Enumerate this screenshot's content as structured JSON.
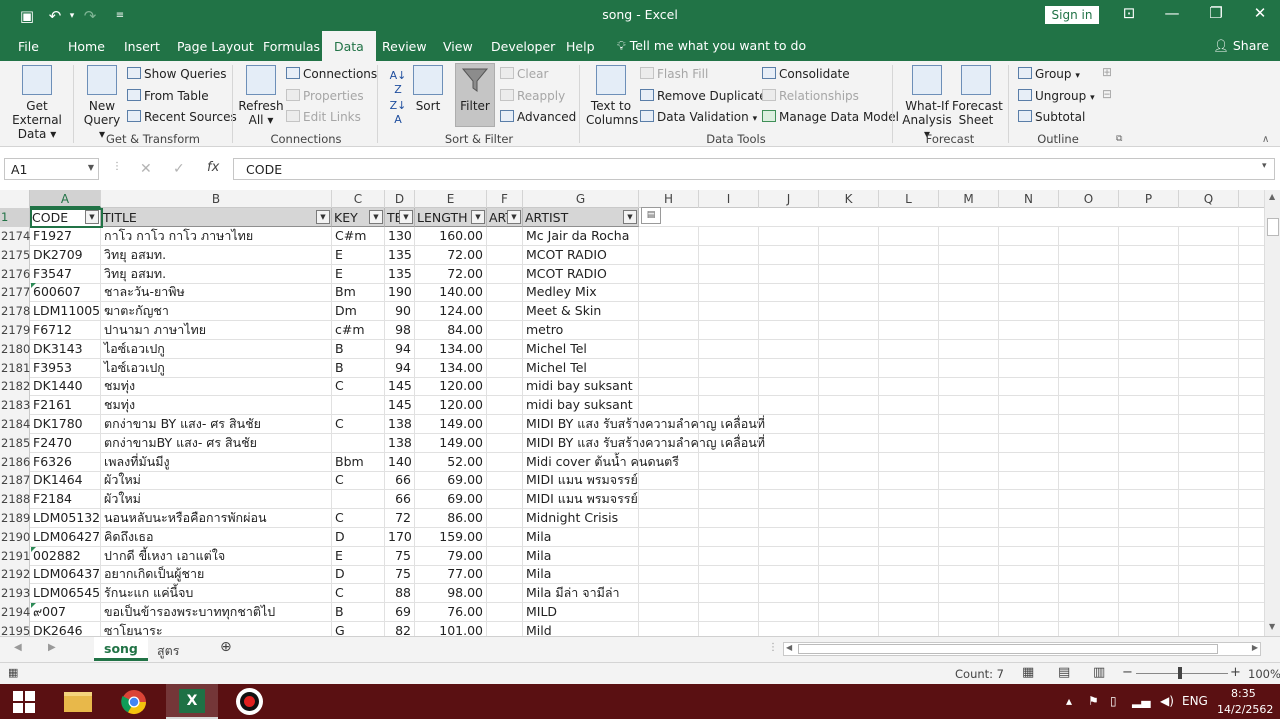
{
  "window": {
    "title": "song  -  Excel",
    "sign_in": "Sign in"
  },
  "tabs": {
    "file": "File",
    "home": "Home",
    "insert": "Insert",
    "page_layout": "Page Layout",
    "formulas": "Formulas",
    "data": "Data",
    "review": "Review",
    "view": "View",
    "developer": "Developer",
    "help": "Help",
    "tell_me": "Tell me what you want to do",
    "share": "Share"
  },
  "ribbon": {
    "get_external_data": [
      "Get External",
      "Data ▾"
    ],
    "new_query": [
      "New",
      "Query ▾"
    ],
    "show_queries": "Show Queries",
    "from_table": "From Table",
    "recent_sources": "Recent Sources",
    "get_transform_label": "Get & Transform",
    "refresh_all": [
      "Refresh",
      "All ▾"
    ],
    "connections": "Connections",
    "properties": "Properties",
    "edit_links": "Edit Links",
    "connections_label": "Connections",
    "sort": "Sort",
    "filter": "Filter",
    "clear": "Clear",
    "reapply": "Reapply",
    "advanced": "Advanced",
    "sort_filter_label": "Sort & Filter",
    "text_to_columns": [
      "Text to",
      "Columns"
    ],
    "flash_fill": "Flash Fill",
    "remove_duplicates": "Remove Duplicates",
    "data_validation": "Data Validation",
    "consolidate": "Consolidate",
    "relationships": "Relationships",
    "manage_data_model": "Manage Data Model",
    "data_tools_label": "Data Tools",
    "what_if": [
      "What-If",
      "Analysis ▾"
    ],
    "forecast_sheet": [
      "Forecast",
      "Sheet"
    ],
    "forecast_label": "Forecast",
    "group": "Group",
    "ungroup": "Ungroup",
    "subtotal": "Subtotal",
    "outline_label": "Outline"
  },
  "formula_bar": {
    "name_box": "A1",
    "cancel": "✕",
    "enter": "✓",
    "fx": "fx",
    "value": "CODE"
  },
  "columns": [
    "A",
    "B",
    "C",
    "D",
    "E",
    "F",
    "G",
    "H",
    "I",
    "J",
    "K",
    "L",
    "M",
    "N",
    "O",
    "P",
    "Q"
  ],
  "header_row": {
    "row_number": "1",
    "cells": [
      "CODE",
      "TITLE",
      "KEY",
      "TE",
      "LENGTH",
      "ART",
      "ARTIST"
    ]
  },
  "rows": [
    {
      "n": "2174",
      "code": "F1927",
      "title": "กาโว กาโว กาโว ภาษาไทย",
      "key": "C#m",
      "tempo": "130",
      "length": "160.00",
      "artist": "Mc Jair da Rocha",
      "tri": false
    },
    {
      "n": "2175",
      "code": "DK2709",
      "title": "วิทยุ อสมท.",
      "key": "E",
      "tempo": "135",
      "length": "72.00",
      "artist": "MCOT RADIO",
      "tri": false
    },
    {
      "n": "2176",
      "code": "F3547",
      "title": "วิทยุ อสมท.",
      "key": "E",
      "tempo": "135",
      "length": "72.00",
      "artist": "MCOT RADIO",
      "tri": false
    },
    {
      "n": "2177",
      "code": "600607",
      "title": "ชาละวัน-ยาพิษ",
      "key": "Bm",
      "tempo": "190",
      "length": "140.00",
      "artist": "Medley Mix",
      "tri": true
    },
    {
      "n": "2178",
      "code": "LDM11005",
      "title": "ฆาตะกัญชา",
      "key": "Dm",
      "tempo": "90",
      "length": "124.00",
      "artist": "Meet & Skin",
      "tri": false
    },
    {
      "n": "2179",
      "code": "F6712",
      "title": "ปานามา ภาษาไทย",
      "key": "c#m",
      "tempo": "98",
      "length": "84.00",
      "artist": "metro",
      "tri": false
    },
    {
      "n": "2180",
      "code": "DK3143",
      "title": "ไอซ์เอวเปกู",
      "key": "B",
      "tempo": "94",
      "length": "134.00",
      "artist": "Michel Tel",
      "tri": false
    },
    {
      "n": "2181",
      "code": "F3953",
      "title": "ไอซ์เอวเปกู",
      "key": "B",
      "tempo": "94",
      "length": "134.00",
      "artist": "Michel Tel",
      "tri": false
    },
    {
      "n": "2182",
      "code": "DK1440",
      "title": "ชมทุ่ง",
      "key": "C",
      "tempo": "145",
      "length": "120.00",
      "artist": "midi bay suksant",
      "tri": false
    },
    {
      "n": "2183",
      "code": "F2161",
      "title": "ชมทุ่ง",
      "key": "",
      "tempo": "145",
      "length": "120.00",
      "artist": "midi bay suksant",
      "tri": false
    },
    {
      "n": "2184",
      "code": "DK1780",
      "title": "ตกง่าขาม  BY แสง- ศร สินชัย",
      "key": "C",
      "tempo": "138",
      "length": "149.00",
      "artist": "MIDI BY  แสง  รับสร้างความลำคาญ เคลื่อนที่",
      "tri": false
    },
    {
      "n": "2185",
      "code": "F2470",
      "title": "ตกง่าขามBY แสง- ศร สินชัย",
      "key": "",
      "tempo": "138",
      "length": "149.00",
      "artist": "MIDI BY  แสง  รับสร้างความลำคาญ เคลื่อนที่",
      "tri": false
    },
    {
      "n": "2186",
      "code": "F6326",
      "title": "เพลงที่มันมีงู",
      "key": "Bbm",
      "tempo": "140",
      "length": "52.00",
      "artist": "Midi cover ต้นน้ำ คนดนตรี",
      "tri": false
    },
    {
      "n": "2187",
      "code": "DK1464",
      "title": "ผัวใหม่",
      "key": "C",
      "tempo": "66",
      "length": "69.00",
      "artist": "MIDI แมน พรมจรรย์",
      "tri": false
    },
    {
      "n": "2188",
      "code": "F2184",
      "title": "ผัวใหม่",
      "key": "",
      "tempo": "66",
      "length": "69.00",
      "artist": "MIDI แมน พรมจรรย์",
      "tri": false
    },
    {
      "n": "2189",
      "code": "LDM05132",
      "title": "นอนหลับนะหรือคือการพักผ่อน",
      "key": "C",
      "tempo": "72",
      "length": "86.00",
      "artist": "Midnight Crisis",
      "tri": false
    },
    {
      "n": "2190",
      "code": "LDM06427",
      "title": "คิดถึงเธอ",
      "key": "D",
      "tempo": "170",
      "length": "159.00",
      "artist": "Mila",
      "tri": false
    },
    {
      "n": "2191",
      "code": "002882",
      "title": "ปากดี ขี้เหงา เอาแต่ใจ",
      "key": "E",
      "tempo": "75",
      "length": "79.00",
      "artist": "Mila",
      "tri": true
    },
    {
      "n": "2192",
      "code": "LDM06437",
      "title": "อยากเกิดเป็นผู้ชาย",
      "key": "D",
      "tempo": "75",
      "length": "77.00",
      "artist": "Mila",
      "tri": false
    },
    {
      "n": "2193",
      "code": "LDM06545",
      "title": "รักนะแก แค่นี้จบ",
      "key": "C",
      "tempo": "88",
      "length": "98.00",
      "artist": "Mila มีล่า จามีล่า",
      "tri": false
    },
    {
      "n": "2194",
      "code": "๙007",
      "title": "ขอเป็นข้ารองพระบาททุกชาติไป",
      "key": "B",
      "tempo": "69",
      "length": "76.00",
      "artist": "MILD",
      "tri": true
    },
    {
      "n": "2195",
      "code": "DK2646",
      "title": "ซาโยนาระ",
      "key": "G",
      "tempo": "82",
      "length": "101.00",
      "artist": "Mild",
      "tri": false
    }
  ],
  "sheets": {
    "active": "song",
    "other": "สูตร",
    "add": "⊕"
  },
  "status": {
    "count": "Count: 7",
    "zoom": "100%"
  },
  "taskbar": {
    "lang": "ENG",
    "time": "8:35",
    "date": "14/2/2562"
  },
  "colors": {
    "excel_green": "#217346",
    "taskbar": "#5a1012"
  }
}
